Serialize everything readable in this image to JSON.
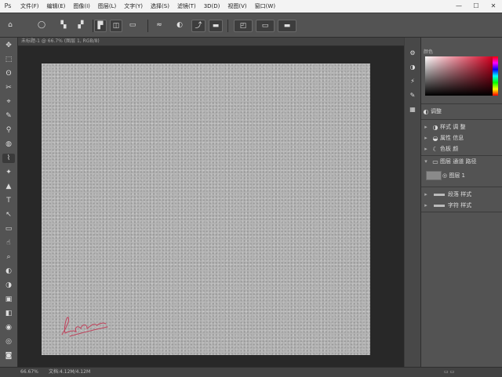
{
  "menubar": {
    "logo": "Ps",
    "items": [
      "文件(F)",
      "编辑(E)",
      "图像(I)",
      "图层(L)",
      "文字(Y)",
      "选择(S)",
      "滤镜(T)",
      "3D(D)",
      "视图(V)",
      "窗口(W)"
    ],
    "controls": [
      "—",
      "☐",
      "✕"
    ]
  },
  "optbar": {
    "tool_icon": "⌂",
    "brush_size": "◯",
    "mode_icons": [
      "▚",
      "▞",
      "▛",
      "◫",
      "▭",
      "≈",
      "◐",
      "⤴",
      "▬",
      "◰"
    ]
  },
  "tools": [
    "✥",
    "⬚",
    "ʘ",
    "✂",
    "⌖",
    "✎",
    "⚲",
    "◍",
    "⌇",
    "✦",
    "▲",
    "T",
    "↖",
    "▭",
    "☝",
    "⌕",
    "◐",
    "◑",
    "▣",
    "◧",
    "◉",
    "◎",
    "◙"
  ],
  "document": {
    "tab": "未标题-1 @ 66.7% (图层 1, RGB/8)",
    "signature": "Luca"
  },
  "right_strip_icons": [
    "⚙",
    "◑",
    "⚡",
    "✎",
    "▦"
  ],
  "panels": {
    "color_tab": "颜色",
    "rows": [
      {
        "icon": "◐",
        "label": "调整"
      },
      {
        "icon": "◑",
        "label": "样式 调 整"
      },
      {
        "icon": "◒",
        "label": "属性 信息"
      },
      {
        "icon": "☾",
        "label": "色板 颜"
      },
      {
        "icon": "▭",
        "label": "图层 通道 路径"
      },
      {
        "icon": "▭",
        "label": "◎ 图层 1"
      },
      {
        "icon": "▬",
        "label": "段落 样式"
      },
      {
        "icon": "▬",
        "label": "字符 样式"
      }
    ]
  },
  "status": {
    "zoom": "66.67%",
    "doc_size": "文档:4.12M/4.12M"
  }
}
